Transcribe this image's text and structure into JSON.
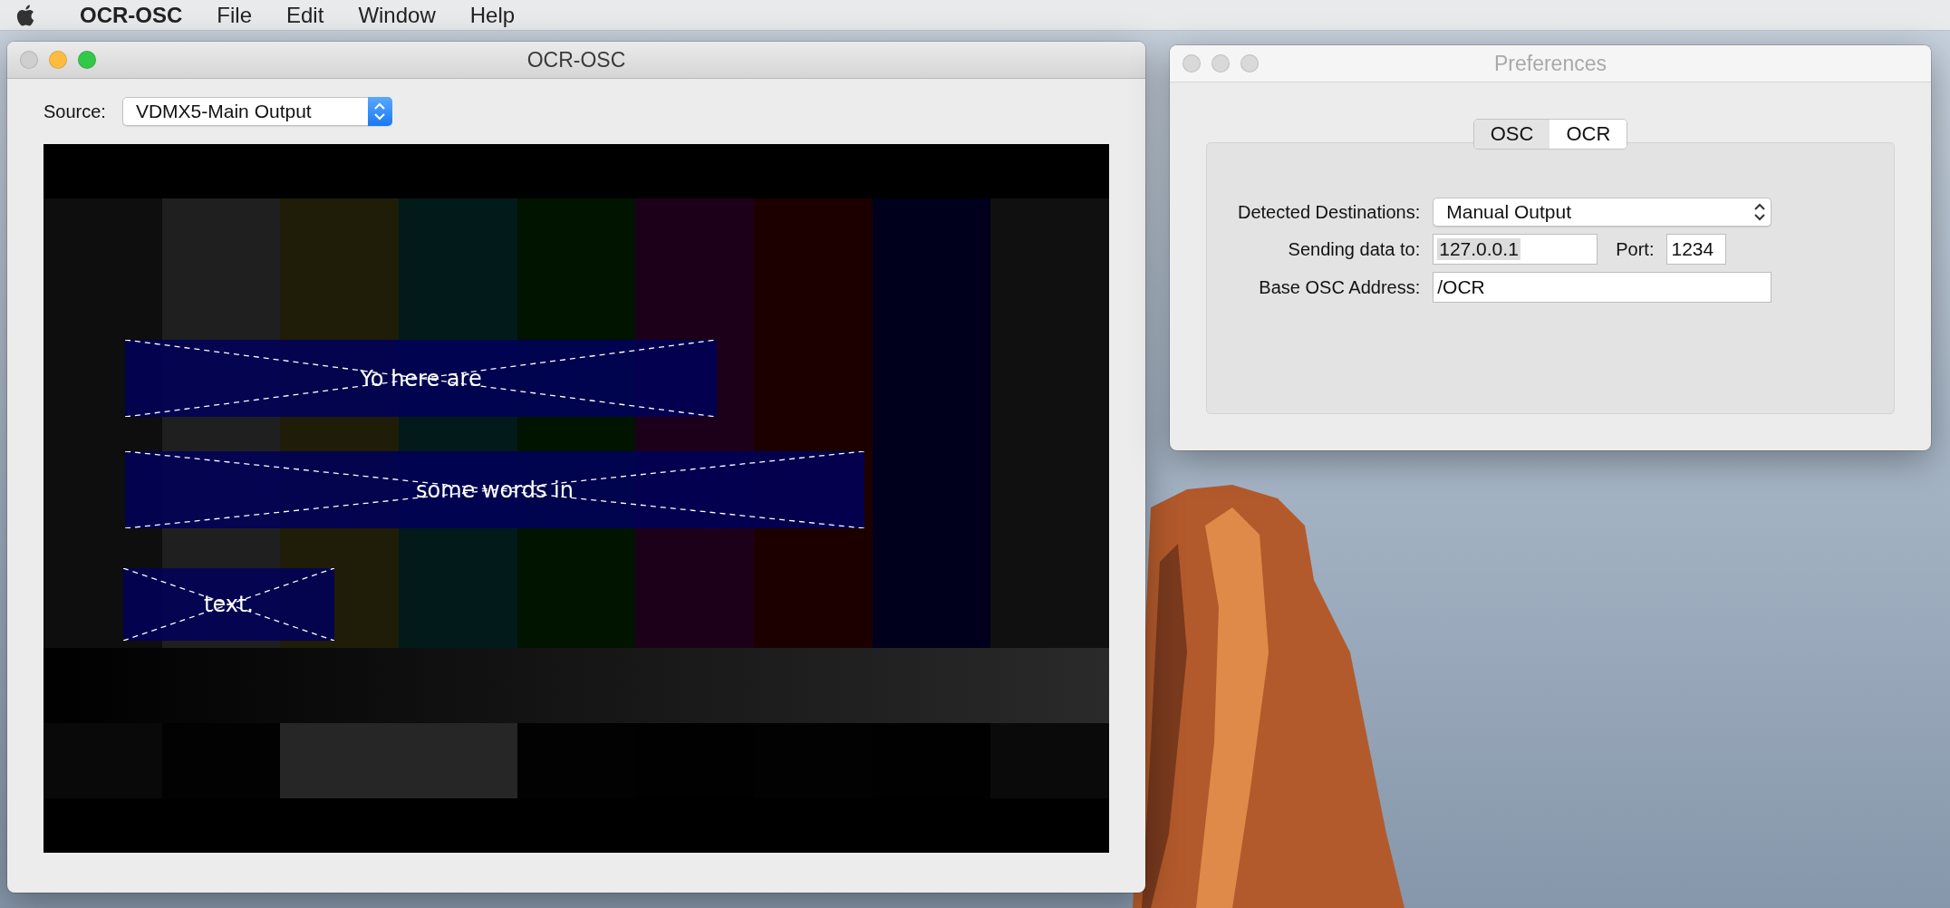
{
  "menu_bar": {
    "app_name": "OCR-OSC",
    "items": [
      "File",
      "Edit",
      "Window",
      "Help"
    ]
  },
  "main_window": {
    "title": "OCR-OSC",
    "active": true,
    "source": {
      "label": "Source:",
      "value": "VDMX5-Main Output"
    },
    "detections": [
      {
        "text": "Yo here are"
      },
      {
        "text": "some words in"
      },
      {
        "text": "text."
      }
    ]
  },
  "preferences": {
    "title": "Preferences",
    "active": false,
    "tabs": [
      {
        "label": "OSC",
        "selected": true
      },
      {
        "label": "OCR",
        "selected": false
      }
    ],
    "detected_destinations": {
      "label": "Detected Destinations:",
      "value": "Manual Output"
    },
    "sending": {
      "label": "Sending data to:",
      "value": "127.0.0.1",
      "text_selected": true
    },
    "port": {
      "label": "Port:",
      "value": "1234"
    },
    "base_address": {
      "label": "Base OSC Address:",
      "value": "/OCR"
    }
  }
}
